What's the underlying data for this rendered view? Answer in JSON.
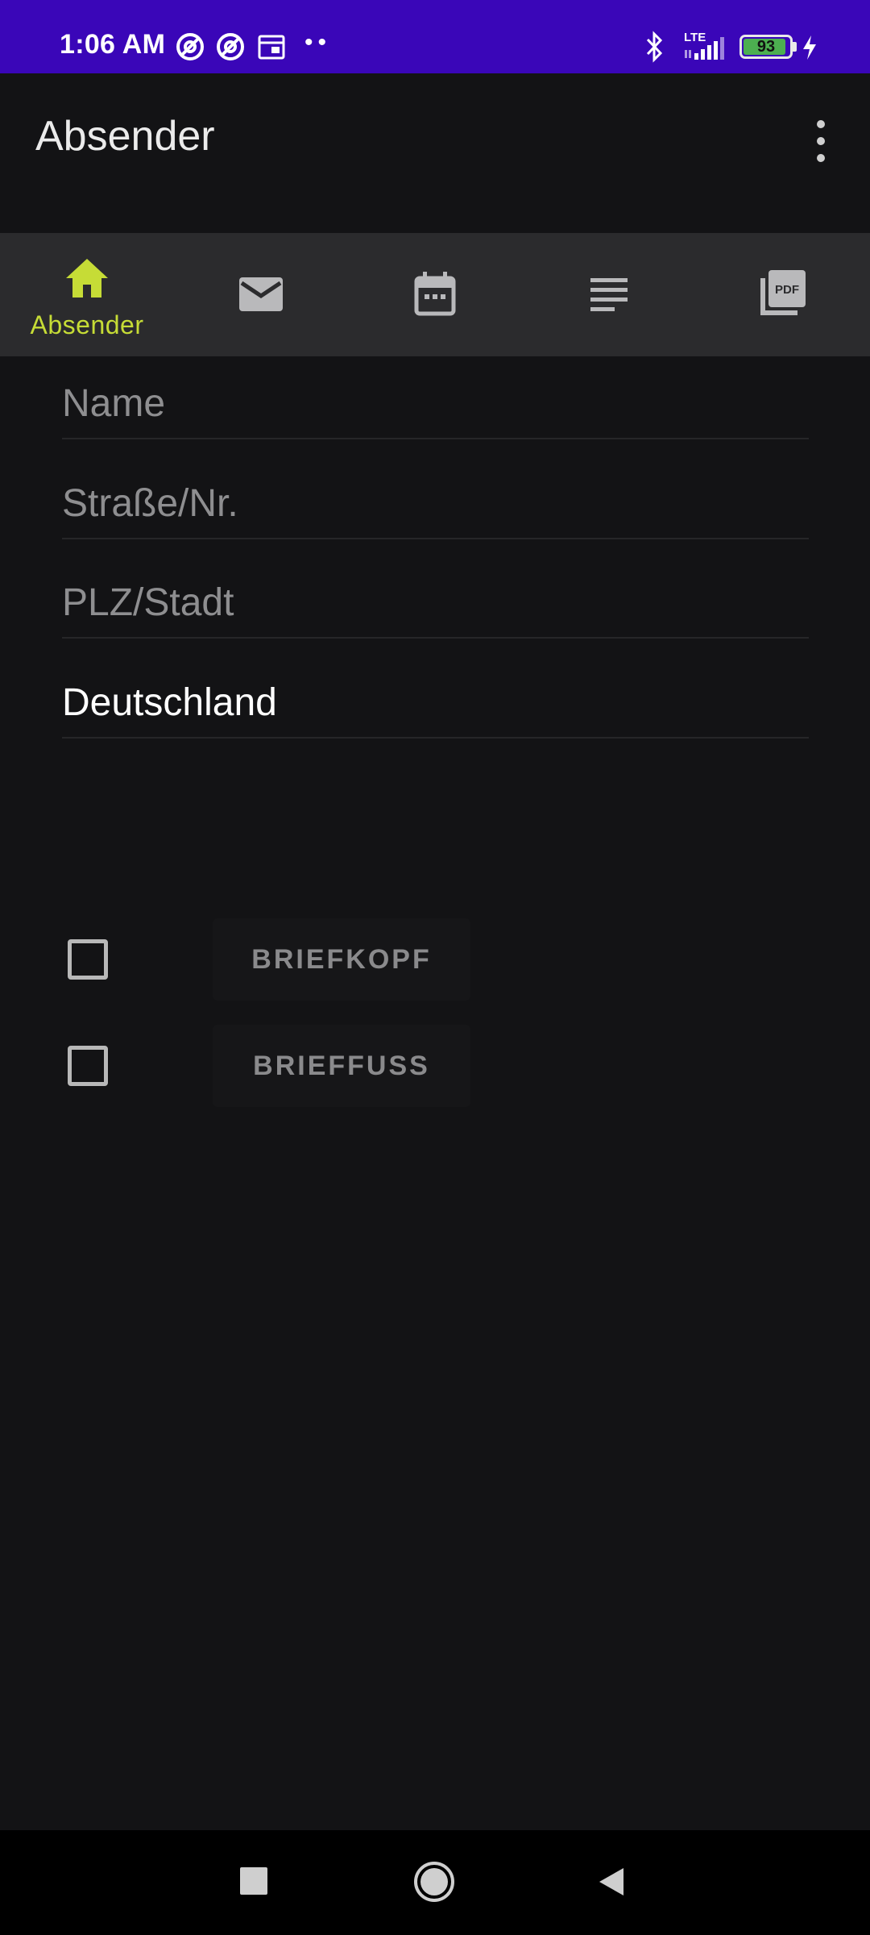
{
  "status_bar": {
    "time": "1:06 AM",
    "dots": "••",
    "network": "LTE",
    "battery": "93",
    "battery_level": 0.93,
    "background_color": "#3a06b8",
    "icons": [
      "at-sign-icon",
      "at-sign-icon",
      "calendar-icon",
      "bluetooth-icon",
      "signal-icon",
      "charging-icon"
    ]
  },
  "app_bar": {
    "title": "Absender",
    "menu_icon": "more-vert-icon"
  },
  "tabs": [
    {
      "label": "Absender",
      "icon": "home-icon",
      "selected": true
    },
    {
      "label": "",
      "icon": "mail-icon",
      "selected": false
    },
    {
      "label": "",
      "icon": "calendar-icon",
      "selected": false
    },
    {
      "label": "",
      "icon": "subject-lines-icon",
      "selected": false
    },
    {
      "label": "",
      "icon": "pdf-icon",
      "selected": false
    }
  ],
  "accent_color": "#c6dc36",
  "form": {
    "name": {
      "placeholder": "Name",
      "value": ""
    },
    "street": {
      "placeholder": "Straße/Nr.",
      "value": ""
    },
    "city": {
      "placeholder": "PLZ/Stadt",
      "value": ""
    },
    "country": {
      "placeholder": "",
      "value": "Deutschland"
    }
  },
  "options": [
    {
      "label": "BRIEFKOPF",
      "checked": false
    },
    {
      "label": "BRIEFFUSS",
      "checked": false
    }
  ],
  "nav_bar": {
    "icons": [
      "recents-square-icon",
      "home-circle-icon",
      "back-triangle-icon"
    ]
  }
}
